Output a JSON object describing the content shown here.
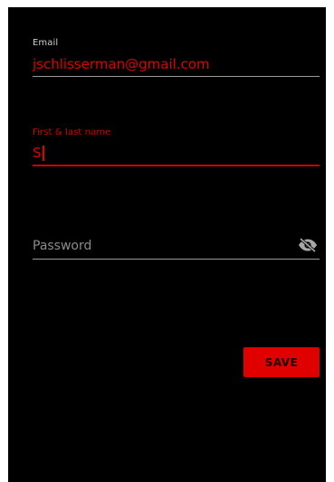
{
  "form": {
    "email": {
      "label": "Email",
      "value": "jschlisserman@gmail.com"
    },
    "name": {
      "label": "First & last name",
      "value": "S"
    },
    "password": {
      "placeholder": "Password",
      "toggle_icon": "visibility-off-icon"
    },
    "save_label": "SAVE"
  },
  "colors": {
    "background": "#000000",
    "accent": "#e00000",
    "label": "#cfcfcf",
    "underline": "#9a9a9a",
    "placeholder": "#8c8c8c"
  }
}
